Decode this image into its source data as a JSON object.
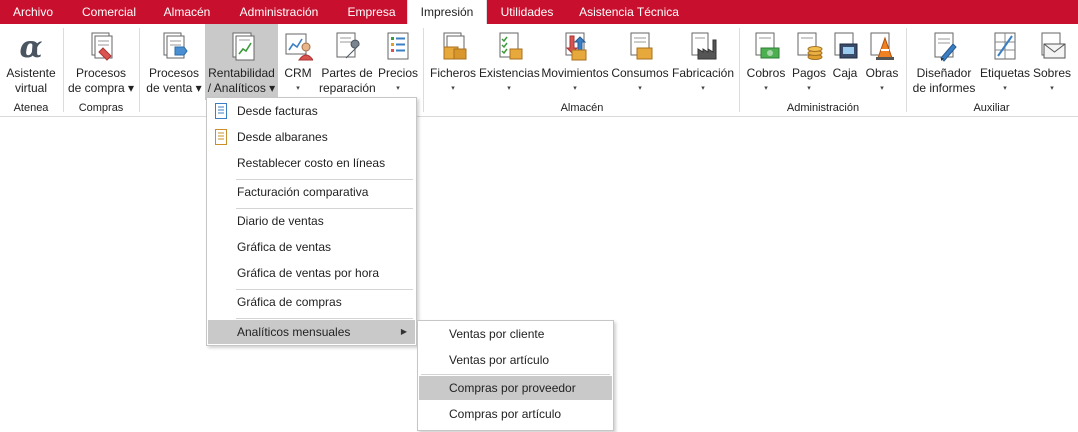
{
  "tabs": [
    {
      "label": "Archivo"
    },
    {
      "label": "Comercial"
    },
    {
      "label": "Almacén"
    },
    {
      "label": "Administración"
    },
    {
      "label": "Empresa"
    },
    {
      "label": "Impresión"
    },
    {
      "label": "Utilidades"
    },
    {
      "label": "Asistencia Técnica"
    }
  ],
  "ribbon": {
    "asistente": {
      "line1": "Asistente",
      "line2": "virtual",
      "icon": "alpha-icon"
    },
    "procesos_compra": {
      "line1": "Procesos",
      "line2": "de compra ▾",
      "icon": "purchase-docs-icon"
    },
    "procesos_venta": {
      "line1": "Procesos",
      "line2": "de venta ▾",
      "icon": "sales-docs-icon"
    },
    "rentabilidad": {
      "line1": "Rentabilidad",
      "line2": "/ Analíticos ▾",
      "icon": "profit-chart-icon"
    },
    "crm": {
      "line1": "CRM",
      "line2": "▾",
      "icon": "crm-icon"
    },
    "partes": {
      "line1": "Partes de",
      "line2": "reparación",
      "icon": "wrench-icon"
    },
    "precios": {
      "line1": "Precios",
      "line2": "▾",
      "icon": "price-list-icon"
    },
    "ficheros": {
      "line1": "Ficheros",
      "line2": "▾",
      "icon": "files-icon"
    },
    "existencias": {
      "line1": "Existencias",
      "line2": "▾",
      "icon": "stock-icon"
    },
    "movimientos": {
      "line1": "Movimientos",
      "line2": "▾",
      "icon": "movements-icon"
    },
    "consumos": {
      "line1": "Consumos",
      "line2": "▾",
      "icon": "consumption-icon"
    },
    "fabricacion": {
      "line1": "Fabricación",
      "line2": "▾",
      "icon": "factory-icon"
    },
    "cobros": {
      "line1": "Cobros",
      "line2": "▾",
      "icon": "cash-in-icon"
    },
    "pagos": {
      "line1": "Pagos",
      "line2": "▾",
      "icon": "cash-out-icon"
    },
    "caja": {
      "line1": "Caja",
      "line2": "",
      "icon": "cash-box-icon"
    },
    "obras": {
      "line1": "Obras",
      "line2": "▾",
      "icon": "cone-icon"
    },
    "disenador": {
      "line1": "Diseñador",
      "line2": "de informes",
      "icon": "designer-icon"
    },
    "etiquetas": {
      "line1": "Etiquetas",
      "line2": "▾",
      "icon": "labels-icon"
    },
    "sobres": {
      "line1": "Sobres",
      "line2": "▾",
      "icon": "envelope-icon"
    }
  },
  "groups": {
    "atenea": "Atenea",
    "compras": "Compras",
    "almacen": "Almacén",
    "administracion": "Administración",
    "auxiliar": "Auxiliar"
  },
  "menu": {
    "items": [
      "Desde facturas",
      "Desde albaranes",
      "Restablecer costo en líneas",
      "Facturación comparativa",
      "Diario de ventas",
      "Gráfica de ventas",
      "Gráfica de ventas por hora",
      "Gráfica de compras",
      "Analíticos mensuales"
    ],
    "submenu_arrow": "▶"
  },
  "submenu": {
    "items": [
      "Ventas por cliente",
      "Ventas por artículo",
      "Compras por proveedor",
      "Compras por artículo"
    ]
  },
  "colors": {
    "accent": "#c8102e",
    "highlight": "#c9c9c9"
  }
}
